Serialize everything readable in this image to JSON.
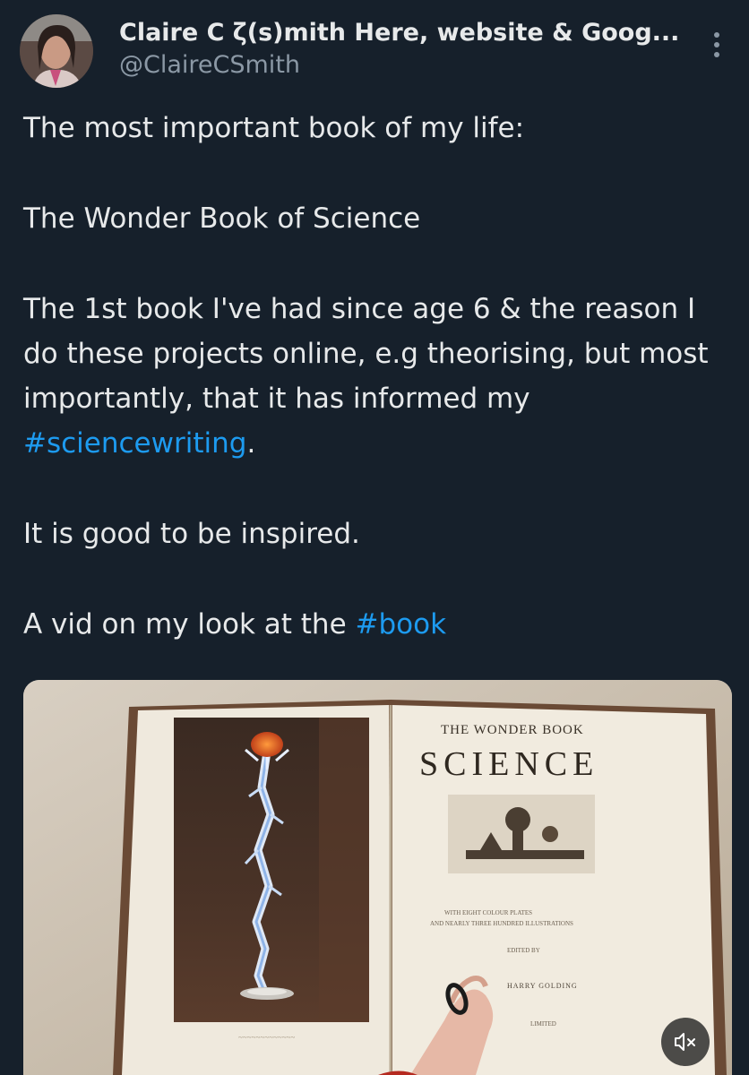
{
  "author": {
    "display_name": "Claire C ζ(s)mith Here, website & Goog...",
    "handle": "@ClaireCSmith"
  },
  "tweet": {
    "p1": "The most important book of my life:",
    "p2": "The Wonder Book of Science",
    "p3_text": "The 1st book I've had since age 6 & the reason I do these projects online, e.g theorising, but most importantly, that it has informed my ",
    "p3_hashtag": "#sciencewriting",
    "p3_end": ".",
    "p4": "It is good to be inspired.",
    "p5_text": "A vid on my look at the ",
    "p5_hashtag": "#book"
  },
  "media": {
    "book_title_top": "THE WONDER BOOK",
    "book_title_main": "SCIENCE",
    "book_author": "HARRY GOLDING",
    "icons": {
      "mute": "volume-muted-icon",
      "more": "more-vertical-icon"
    }
  },
  "colors": {
    "background": "#16202b",
    "text": "#e7e9ea",
    "secondary": "#8b98a5",
    "accent": "#1d9bf0"
  }
}
